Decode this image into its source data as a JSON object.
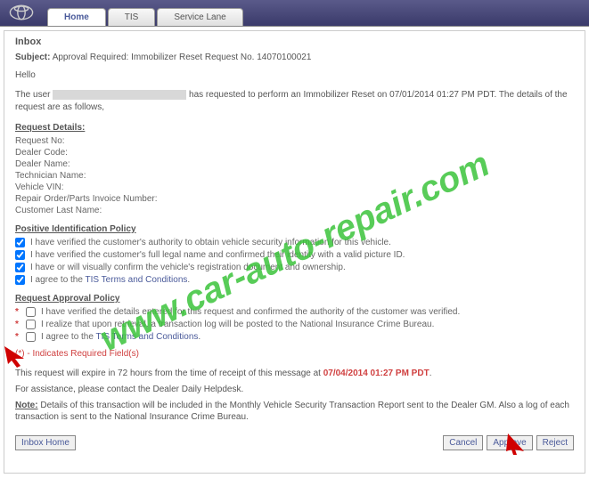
{
  "tabs": {
    "home": "Home",
    "tis": "TIS",
    "service_lane": "Service Lane"
  },
  "inbox": {
    "title": "Inbox",
    "subject_label": "Subject:",
    "subject_value": "Approval Required: Immobilizer Reset Request No. 14070100021",
    "hello": "Hello",
    "user_prefix": "The user",
    "user_suffix": "has requested to perform an Immobilizer Reset on 07/01/2014 01:27 PM PDT. The details of the request are as follows,"
  },
  "request_details": {
    "header": "Request Details:",
    "rows": {
      "request_no": "Request No:",
      "dealer_code": "Dealer Code:",
      "dealer_name": "Dealer Name:",
      "technician_name": "Technician Name:",
      "vehicle_vin": "Vehicle VIN:",
      "repair_order": "Repair Order/Parts Invoice Number:",
      "customer_last": "Customer Last Name:"
    }
  },
  "positive_id": {
    "header": "Positive Identification Policy",
    "items": {
      "c1": "I have verified the customer's authority to obtain vehicle security information for this vehicle.",
      "c2": "I have verified the customer's full legal name and confirmed their identity with a valid picture ID.",
      "c3": "I have or will visually confirm the vehicle's registration document and ownership.",
      "c4_pre": "I agree to the ",
      "c4_link": "TIS Terms and Conditions",
      "c4_post": "."
    }
  },
  "approval": {
    "header": "Request Approval Policy",
    "items": {
      "a1": "I have verified the details entered for this request and confirmed the authority of the customer was verified.",
      "a2": "I realize that upon retrieval, a transaction log will be posted to the National Insurance Crime Bureau.",
      "a3_pre": "I agree to the ",
      "a3_link": "TIS Terms and Conditions",
      "a3_post": "."
    }
  },
  "required_note": "(*) - Indicates Required Field(s)",
  "expiry": {
    "text": "This request will expire in 72 hours from the time of receipt of this message at ",
    "datetime": "07/04/2014 01:27 PM PDT",
    "suffix": "."
  },
  "assistance": "For assistance, please contact the Dealer Daily Helpdesk.",
  "note": {
    "label": "Note:",
    "text": " Details of this transaction will be included in the Monthly Vehicle Security Transaction Report sent to the Dealer GM. Also a log of each transaction is sent to the National Insurance Crime Bureau."
  },
  "buttons": {
    "inbox_home": "Inbox Home",
    "cancel": "Cancel",
    "approve": "Approve",
    "reject": "Reject"
  },
  "watermark": "www.car-auto-repair.com"
}
